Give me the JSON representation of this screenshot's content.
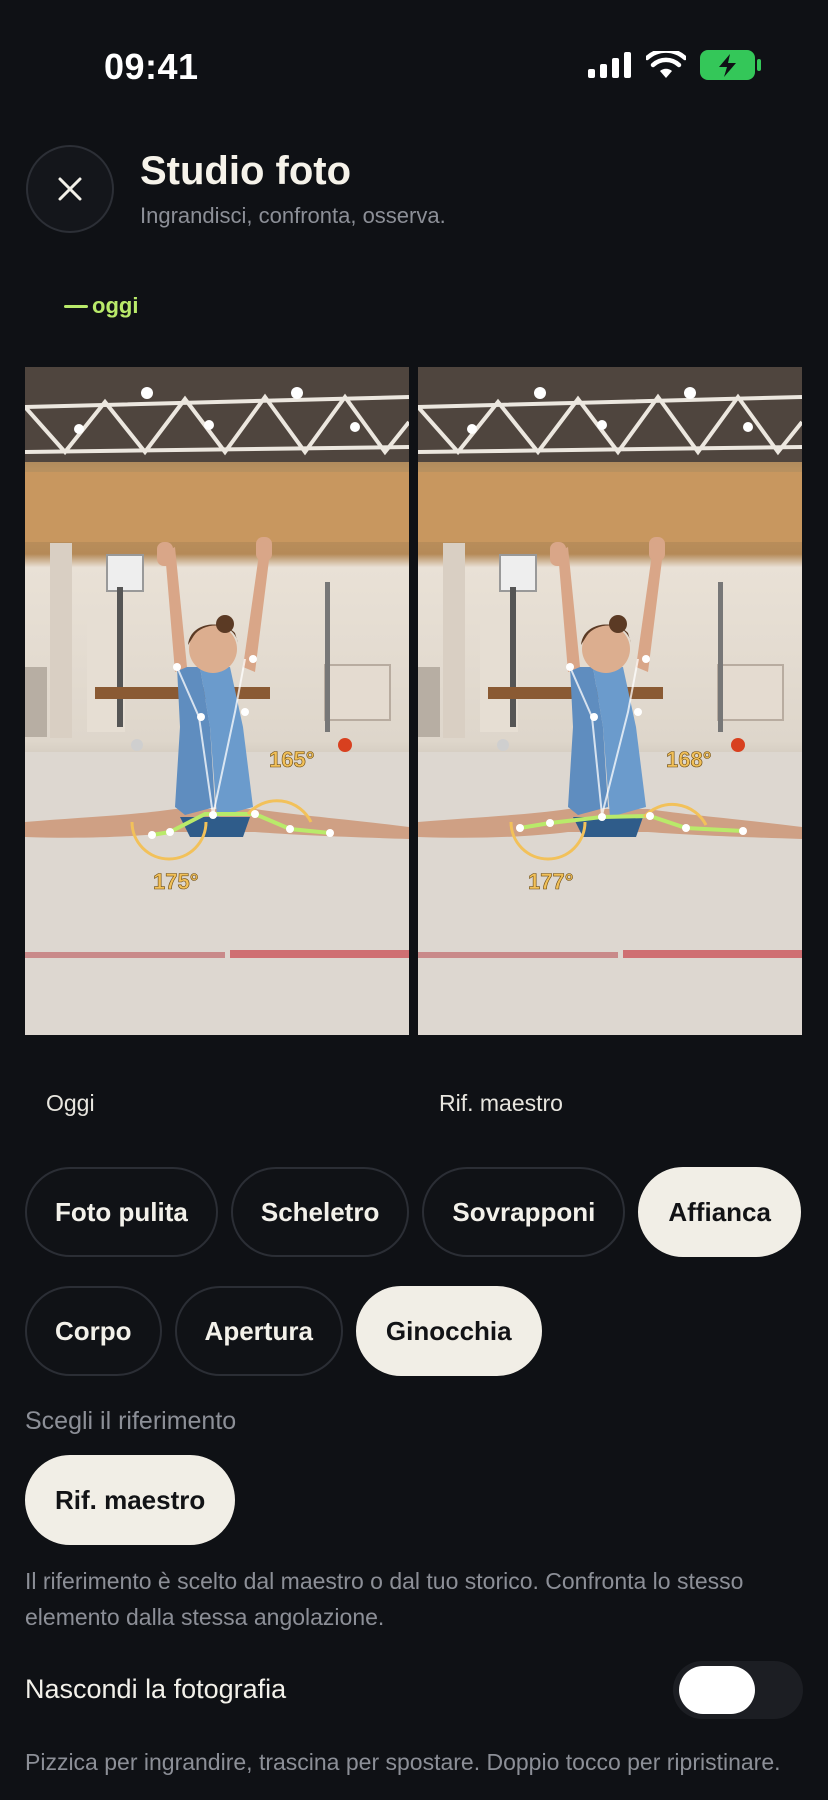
{
  "status_bar": {
    "time": "09:41"
  },
  "header": {
    "title": "Studio foto",
    "subtitle": "Ingrandisci, confronta, osserva."
  },
  "legend": {
    "label": "oggi",
    "color": "#b9ea6a"
  },
  "photos": {
    "left": {
      "label": "Oggi",
      "angle_top": "165°",
      "angle_bottom": "175°"
    },
    "right": {
      "label": "Rif. maestro",
      "angle_top": "168°",
      "angle_bottom": "177°"
    }
  },
  "view_modes": [
    {
      "label": "Foto pulita",
      "active": false
    },
    {
      "label": "Scheletro",
      "active": false
    },
    {
      "label": "Sovrapponi",
      "active": false
    },
    {
      "label": "Affianca",
      "active": true
    }
  ],
  "focus_modes": [
    {
      "label": "Corpo",
      "active": false
    },
    {
      "label": "Apertura",
      "active": false
    },
    {
      "label": "Ginocchia",
      "active": true
    }
  ],
  "reference": {
    "section_label": "Scegli il riferimento",
    "selected": "Rif. maestro",
    "note": "Il riferimento è scelto dal maestro o dal tuo storico. Confronta lo stesso elemento dalla stessa angolazione."
  },
  "hide_photo": {
    "label": "Nascondi la fotografia",
    "enabled": true
  },
  "hint": "Pizzica per ingrandire, trascina per spostare. Doppio tocco per ripristinare.",
  "colors": {
    "background": "#0f1115",
    "accent_green": "#b9ea6a",
    "angle_yellow": "#f2c15a",
    "battery_green": "#34c759"
  }
}
